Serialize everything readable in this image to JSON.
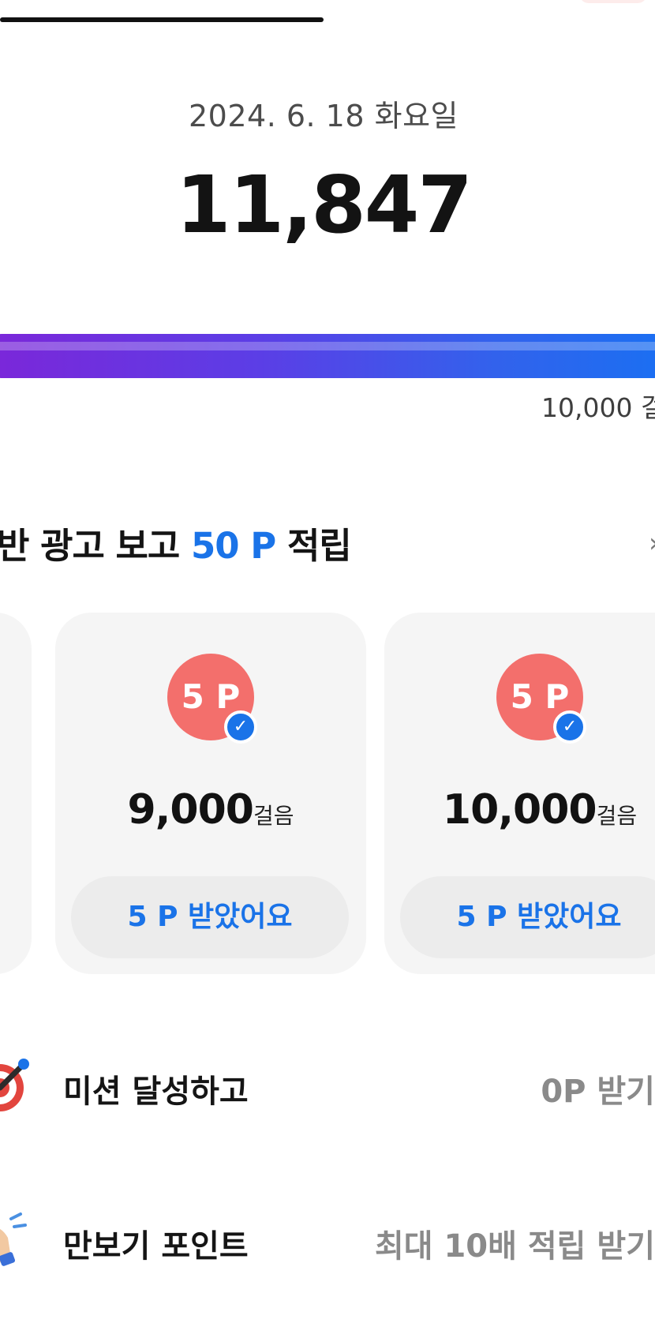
{
  "header": {
    "date": "2024. 6. 18 화요일",
    "steps": "11,847"
  },
  "progress": {
    "fraction": 1.0,
    "goal_label": "10,000 걸"
  },
  "ad_section": {
    "title_prefix": "반 광고 보고 ",
    "title_accent": "50 P",
    "title_suffix": " 적립"
  },
  "cards": [
    {
      "badge": "5 P",
      "steps": "9,000",
      "unit": "걸음",
      "button": "5 P 받았어요"
    },
    {
      "badge": "5 P",
      "steps": "10,000",
      "unit": "걸음",
      "button": "5 P 받았어요"
    }
  ],
  "list": [
    {
      "title": "미션 달성하고",
      "value": "0P 받기",
      "icon": "target-icon"
    },
    {
      "title": "만보기 포인트",
      "value": "최대 10배 적립 받기",
      "icon": "hand-icon"
    }
  ],
  "colors": {
    "accent": "#1a73e8",
    "badge": "#f36f6c",
    "gradient_start": "#7b27d9",
    "gradient_end": "#1b6ff2"
  }
}
